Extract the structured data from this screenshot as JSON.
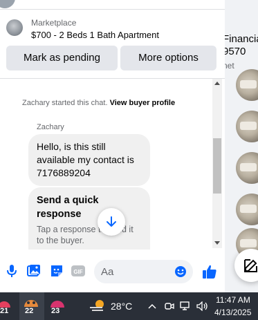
{
  "listing": {
    "label": "Marketplace",
    "title": "$700 - 2 Beds 1 Bath Apartment"
  },
  "actions": {
    "pending_label": "Mark as pending",
    "more_label": "More options"
  },
  "chat": {
    "system_prefix": "Zachary started this chat.",
    "system_link": "View buyer profile",
    "sender_name": "Zachary",
    "message": "Hello, is this still available my contact is 7176889204",
    "quick_title": "Send a quick response",
    "quick_text": "Tap a response to send it to the buyer."
  },
  "composer": {
    "placeholder": "Aa"
  },
  "background": {
    "heading_partial": "Financia",
    "line2_partial": "9570",
    "line3_partial": "net"
  },
  "taskbar": {
    "badge_1": "21",
    "badge_2": "22",
    "badge_3": "23",
    "temperature": "28°C",
    "time": "11:47 AM",
    "date": "4/13/2025"
  },
  "colors": {
    "accent": "#0866ff",
    "button_bg": "#e4e6eb",
    "bubble_bg": "#f0f0f0",
    "taskbar_bg": "#2a2f38"
  }
}
